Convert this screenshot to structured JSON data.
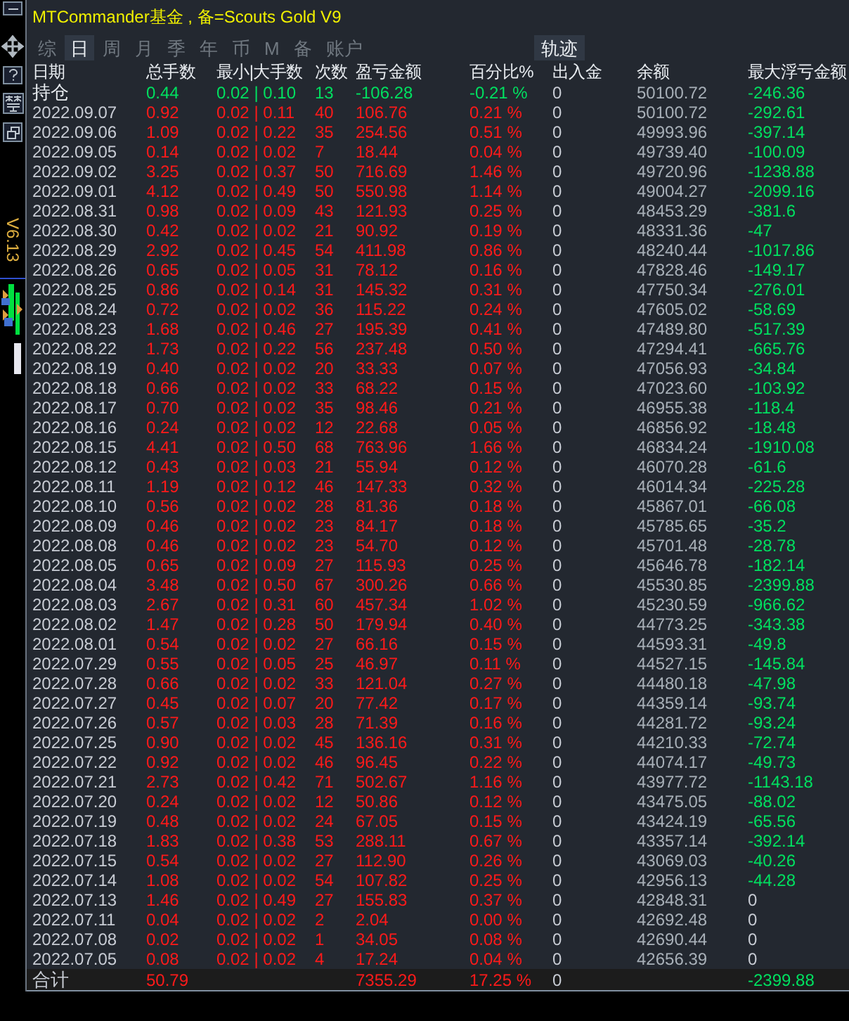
{
  "sidebar": {
    "version": "V6.13"
  },
  "title": "MTCommander基金 , 备=Scouts Gold V9",
  "tabs": [
    {
      "label": "综",
      "selected": false
    },
    {
      "label": "日",
      "selected": true
    },
    {
      "label": "周",
      "selected": false
    },
    {
      "label": "月",
      "selected": false
    },
    {
      "label": "季",
      "selected": false
    },
    {
      "label": "年",
      "selected": false
    },
    {
      "label": "币",
      "selected": false
    },
    {
      "label": "M",
      "selected": false
    },
    {
      "label": "备",
      "selected": false
    },
    {
      "label": "账户",
      "selected": false
    }
  ],
  "track_button": "轨迹",
  "table": {
    "columns": [
      "日期",
      "总手数",
      "最小|大手数",
      "次数",
      "盈亏金额",
      "百分比%",
      "出入金",
      "余额",
      "最大浮亏金额"
    ],
    "rows": [
      {
        "kind": "position",
        "date": "持仓",
        "lots": "0.44",
        "minmax": "0.02 | 0.10",
        "count": "13",
        "pnl": "-106.28",
        "pct": "-0.21 %",
        "flow": "0",
        "balance": "50100.72",
        "drawdown": "-246.36",
        "color": "#00e060"
      },
      {
        "kind": "day",
        "date": "2022.09.07",
        "lots": "0.92",
        "minmax": "0.02 | 0.11",
        "count": "40",
        "pnl": "106.76",
        "pct": "0.21 %",
        "flow": "0",
        "balance": "50100.72",
        "drawdown": "-292.61",
        "color": "#00e060"
      },
      {
        "kind": "day",
        "date": "2022.09.06",
        "lots": "1.09",
        "minmax": "0.02 | 0.22",
        "count": "35",
        "pnl": "254.56",
        "pct": "0.51 %",
        "flow": "0",
        "balance": "49993.96",
        "drawdown": "-397.14",
        "color": "#00e060"
      },
      {
        "kind": "day",
        "date": "2022.09.05",
        "lots": "0.14",
        "minmax": "0.02 | 0.02",
        "count": "7",
        "pnl": "18.44",
        "pct": "0.04 %",
        "flow": "0",
        "balance": "49739.40",
        "drawdown": "-100.09",
        "color": "#00e060"
      },
      {
        "kind": "day",
        "date": "2022.09.02",
        "lots": "3.25",
        "minmax": "0.02 | 0.37",
        "count": "50",
        "pnl": "716.69",
        "pct": "1.46 %",
        "flow": "0",
        "balance": "49720.96",
        "drawdown": "-1238.88",
        "color": "#00e060"
      },
      {
        "kind": "day",
        "date": "2022.09.01",
        "lots": "4.12",
        "minmax": "0.02 | 0.49",
        "count": "50",
        "pnl": "550.98",
        "pct": "1.14 %",
        "flow": "0",
        "balance": "49004.27",
        "drawdown": "-2099.16",
        "color": "#00e060"
      },
      {
        "kind": "day",
        "date": "2022.08.31",
        "lots": "0.98",
        "minmax": "0.02 | 0.09",
        "count": "43",
        "pnl": "121.93",
        "pct": "0.25 %",
        "flow": "0",
        "balance": "48453.29",
        "drawdown": "-381.6",
        "color": "#00e060"
      },
      {
        "kind": "day",
        "date": "2022.08.30",
        "lots": "0.42",
        "minmax": "0.02 | 0.02",
        "count": "21",
        "pnl": "90.92",
        "pct": "0.19 %",
        "flow": "0",
        "balance": "48331.36",
        "drawdown": "-47",
        "color": "#00e060"
      },
      {
        "kind": "day",
        "date": "2022.08.29",
        "lots": "2.92",
        "minmax": "0.02 | 0.45",
        "count": "54",
        "pnl": "411.98",
        "pct": "0.86 %",
        "flow": "0",
        "balance": "48240.44",
        "drawdown": "-1017.86",
        "color": "#00e060"
      },
      {
        "kind": "day",
        "date": "2022.08.26",
        "lots": "0.65",
        "minmax": "0.02 | 0.05",
        "count": "31",
        "pnl": "78.12",
        "pct": "0.16 %",
        "flow": "0",
        "balance": "47828.46",
        "drawdown": "-149.17",
        "color": "#00e060"
      },
      {
        "kind": "day",
        "date": "2022.08.25",
        "lots": "0.86",
        "minmax": "0.02 | 0.14",
        "count": "31",
        "pnl": "145.32",
        "pct": "0.31 %",
        "flow": "0",
        "balance": "47750.34",
        "drawdown": "-276.01",
        "color": "#00e060"
      },
      {
        "kind": "day",
        "date": "2022.08.24",
        "lots": "0.72",
        "minmax": "0.02 | 0.02",
        "count": "36",
        "pnl": "115.22",
        "pct": "0.24 %",
        "flow": "0",
        "balance": "47605.02",
        "drawdown": "-58.69",
        "color": "#00e060"
      },
      {
        "kind": "day",
        "date": "2022.08.23",
        "lots": "1.68",
        "minmax": "0.02 | 0.46",
        "count": "27",
        "pnl": "195.39",
        "pct": "0.41 %",
        "flow": "0",
        "balance": "47489.80",
        "drawdown": "-517.39",
        "color": "#00e060"
      },
      {
        "kind": "day",
        "date": "2022.08.22",
        "lots": "1.73",
        "minmax": "0.02 | 0.22",
        "count": "56",
        "pnl": "237.48",
        "pct": "0.50 %",
        "flow": "0",
        "balance": "47294.41",
        "drawdown": "-665.76",
        "color": "#00e060"
      },
      {
        "kind": "day",
        "date": "2022.08.19",
        "lots": "0.40",
        "minmax": "0.02 | 0.02",
        "count": "20",
        "pnl": "33.33",
        "pct": "0.07 %",
        "flow": "0",
        "balance": "47056.93",
        "drawdown": "-34.84",
        "color": "#00e060"
      },
      {
        "kind": "day",
        "date": "2022.08.18",
        "lots": "0.66",
        "minmax": "0.02 | 0.02",
        "count": "33",
        "pnl": "68.22",
        "pct": "0.15 %",
        "flow": "0",
        "balance": "47023.60",
        "drawdown": "-103.92",
        "color": "#00e060"
      },
      {
        "kind": "day",
        "date": "2022.08.17",
        "lots": "0.70",
        "minmax": "0.02 | 0.02",
        "count": "35",
        "pnl": "98.46",
        "pct": "0.21 %",
        "flow": "0",
        "balance": "46955.38",
        "drawdown": "-118.4",
        "color": "#00e060"
      },
      {
        "kind": "day",
        "date": "2022.08.16",
        "lots": "0.24",
        "minmax": "0.02 | 0.02",
        "count": "12",
        "pnl": "22.68",
        "pct": "0.05 %",
        "flow": "0",
        "balance": "46856.92",
        "drawdown": "-18.48",
        "color": "#00e060"
      },
      {
        "kind": "day",
        "date": "2022.08.15",
        "lots": "4.41",
        "minmax": "0.02 | 0.50",
        "count": "68",
        "pnl": "763.96",
        "pct": "1.66 %",
        "flow": "0",
        "balance": "46834.24",
        "drawdown": "-1910.08",
        "color": "#00e060"
      },
      {
        "kind": "day",
        "date": "2022.08.12",
        "lots": "0.43",
        "minmax": "0.02 | 0.03",
        "count": "21",
        "pnl": "55.94",
        "pct": "0.12 %",
        "flow": "0",
        "balance": "46070.28",
        "drawdown": "-61.6",
        "color": "#00e060"
      },
      {
        "kind": "day",
        "date": "2022.08.11",
        "lots": "1.19",
        "minmax": "0.02 | 0.12",
        "count": "46",
        "pnl": "147.33",
        "pct": "0.32 %",
        "flow": "0",
        "balance": "46014.34",
        "drawdown": "-225.28",
        "color": "#00e060"
      },
      {
        "kind": "day",
        "date": "2022.08.10",
        "lots": "0.56",
        "minmax": "0.02 | 0.02",
        "count": "28",
        "pnl": "81.36",
        "pct": "0.18 %",
        "flow": "0",
        "balance": "45867.01",
        "drawdown": "-66.08",
        "color": "#00e060"
      },
      {
        "kind": "day",
        "date": "2022.08.09",
        "lots": "0.46",
        "minmax": "0.02 | 0.02",
        "count": "23",
        "pnl": "84.17",
        "pct": "0.18 %",
        "flow": "0",
        "balance": "45785.65",
        "drawdown": "-35.2",
        "color": "#00e060"
      },
      {
        "kind": "day",
        "date": "2022.08.08",
        "lots": "0.46",
        "minmax": "0.02 | 0.02",
        "count": "23",
        "pnl": "54.70",
        "pct": "0.12 %",
        "flow": "0",
        "balance": "45701.48",
        "drawdown": "-28.78",
        "color": "#00e060"
      },
      {
        "kind": "day",
        "date": "2022.08.05",
        "lots": "0.65",
        "minmax": "0.02 | 0.09",
        "count": "27",
        "pnl": "115.93",
        "pct": "0.25 %",
        "flow": "0",
        "balance": "45646.78",
        "drawdown": "-182.14",
        "color": "#00e060"
      },
      {
        "kind": "day",
        "date": "2022.08.04",
        "lots": "3.48",
        "minmax": "0.02 | 0.50",
        "count": "67",
        "pnl": "300.26",
        "pct": "0.66 %",
        "flow": "0",
        "balance": "45530.85",
        "drawdown": "-2399.88",
        "color": "#00e060"
      },
      {
        "kind": "day",
        "date": "2022.08.03",
        "lots": "2.67",
        "minmax": "0.02 | 0.31",
        "count": "60",
        "pnl": "457.34",
        "pct": "1.02 %",
        "flow": "0",
        "balance": "45230.59",
        "drawdown": "-966.62",
        "color": "#00e060"
      },
      {
        "kind": "day",
        "date": "2022.08.02",
        "lots": "1.47",
        "minmax": "0.02 | 0.28",
        "count": "50",
        "pnl": "179.94",
        "pct": "0.40 %",
        "flow": "0",
        "balance": "44773.25",
        "drawdown": "-343.38",
        "color": "#00e060"
      },
      {
        "kind": "day",
        "date": "2022.08.01",
        "lots": "0.54",
        "minmax": "0.02 | 0.02",
        "count": "27",
        "pnl": "66.16",
        "pct": "0.15 %",
        "flow": "0",
        "balance": "44593.31",
        "drawdown": "-49.8",
        "color": "#00e060"
      },
      {
        "kind": "day",
        "date": "2022.07.29",
        "lots": "0.55",
        "minmax": "0.02 | 0.05",
        "count": "25",
        "pnl": "46.97",
        "pct": "0.11 %",
        "flow": "0",
        "balance": "44527.15",
        "drawdown": "-145.84",
        "color": "#00e060"
      },
      {
        "kind": "day",
        "date": "2022.07.28",
        "lots": "0.66",
        "minmax": "0.02 | 0.02",
        "count": "33",
        "pnl": "121.04",
        "pct": "0.27 %",
        "flow": "0",
        "balance": "44480.18",
        "drawdown": "-47.98",
        "color": "#00e060"
      },
      {
        "kind": "day",
        "date": "2022.07.27",
        "lots": "0.45",
        "minmax": "0.02 | 0.07",
        "count": "20",
        "pnl": "77.42",
        "pct": "0.17 %",
        "flow": "0",
        "balance": "44359.14",
        "drawdown": "-93.74",
        "color": "#00e060"
      },
      {
        "kind": "day",
        "date": "2022.07.26",
        "lots": "0.57",
        "minmax": "0.02 | 0.03",
        "count": "28",
        "pnl": "71.39",
        "pct": "0.16 %",
        "flow": "0",
        "balance": "44281.72",
        "drawdown": "-93.24",
        "color": "#00e060"
      },
      {
        "kind": "day",
        "date": "2022.07.25",
        "lots": "0.90",
        "minmax": "0.02 | 0.02",
        "count": "45",
        "pnl": "136.16",
        "pct": "0.31 %",
        "flow": "0",
        "balance": "44210.33",
        "drawdown": "-72.74",
        "color": "#00e060"
      },
      {
        "kind": "day",
        "date": "2022.07.22",
        "lots": "0.92",
        "minmax": "0.02 | 0.02",
        "count": "46",
        "pnl": "96.45",
        "pct": "0.22 %",
        "flow": "0",
        "balance": "44074.17",
        "drawdown": "-49.73",
        "color": "#00e060"
      },
      {
        "kind": "day",
        "date": "2022.07.21",
        "lots": "2.73",
        "minmax": "0.02 | 0.42",
        "count": "71",
        "pnl": "502.67",
        "pct": "1.16 %",
        "flow": "0",
        "balance": "43977.72",
        "drawdown": "-1143.18",
        "color": "#00e060"
      },
      {
        "kind": "day",
        "date": "2022.07.20",
        "lots": "0.24",
        "minmax": "0.02 | 0.02",
        "count": "12",
        "pnl": "50.86",
        "pct": "0.12 %",
        "flow": "0",
        "balance": "43475.05",
        "drawdown": "-88.02",
        "color": "#00e060"
      },
      {
        "kind": "day",
        "date": "2022.07.19",
        "lots": "0.48",
        "minmax": "0.02 | 0.02",
        "count": "24",
        "pnl": "67.05",
        "pct": "0.15 %",
        "flow": "0",
        "balance": "43424.19",
        "drawdown": "-65.56",
        "color": "#00e060"
      },
      {
        "kind": "day",
        "date": "2022.07.18",
        "lots": "1.83",
        "minmax": "0.02 | 0.38",
        "count": "53",
        "pnl": "288.11",
        "pct": "0.67 %",
        "flow": "0",
        "balance": "43357.14",
        "drawdown": "-392.14",
        "color": "#00e060"
      },
      {
        "kind": "day",
        "date": "2022.07.15",
        "lots": "0.54",
        "minmax": "0.02 | 0.02",
        "count": "27",
        "pnl": "112.90",
        "pct": "0.26 %",
        "flow": "0",
        "balance": "43069.03",
        "drawdown": "-40.26",
        "color": "#00e060"
      },
      {
        "kind": "day",
        "date": "2022.07.14",
        "lots": "1.08",
        "minmax": "0.02 | 0.02",
        "count": "54",
        "pnl": "107.82",
        "pct": "0.25 %",
        "flow": "0",
        "balance": "42956.13",
        "drawdown": "-44.28",
        "color": "#00e060"
      },
      {
        "kind": "day",
        "date": "2022.07.13",
        "lots": "1.46",
        "minmax": "0.02 | 0.49",
        "count": "27",
        "pnl": "155.83",
        "pct": "0.37 %",
        "flow": "0",
        "balance": "42848.31",
        "drawdown": "0",
        "color": "#c8ccd4"
      },
      {
        "kind": "day",
        "date": "2022.07.11",
        "lots": "0.04",
        "minmax": "0.02 | 0.02",
        "count": "2",
        "pnl": "2.04",
        "pct": "0.00 %",
        "flow": "0",
        "balance": "42692.48",
        "drawdown": "0",
        "color": "#c8ccd4"
      },
      {
        "kind": "day",
        "date": "2022.07.08",
        "lots": "0.02",
        "minmax": "0.02 | 0.02",
        "count": "1",
        "pnl": "34.05",
        "pct": "0.08 %",
        "flow": "0",
        "balance": "42690.44",
        "drawdown": "0",
        "color": "#c8ccd4"
      },
      {
        "kind": "day",
        "date": "2022.07.05",
        "lots": "0.08",
        "minmax": "0.02 | 0.02",
        "count": "4",
        "pnl": "17.24",
        "pct": "0.04 %",
        "flow": "0",
        "balance": "42656.39",
        "drawdown": "0",
        "color": "#c8ccd4"
      }
    ],
    "total": {
      "label": "合计",
      "lots": "50.79",
      "pnl": "7355.29",
      "pct": "17.25 %",
      "flow": "0",
      "drawdown": "-2399.88"
    }
  }
}
